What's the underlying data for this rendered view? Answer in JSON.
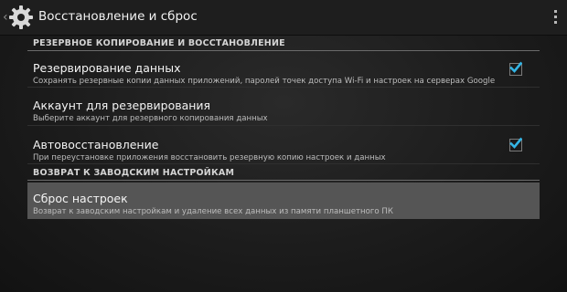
{
  "action_bar": {
    "title": "Восстановление и сброс",
    "up_icon": "chevron-left-icon",
    "app_icon": "gear-icon",
    "menu_icon": "overflow-menu-icon"
  },
  "sections": [
    {
      "header": "РЕЗЕРВНОЕ КОПИРОВАНИЕ И ВОССТАНОВЛЕНИЕ",
      "items": [
        {
          "title": "Резервирование данных",
          "summary": "Сохранять резервные копии данных приложений, паролей точек доступа Wi-Fi и настроек на серверах Google",
          "checked": true
        },
        {
          "title": "Аккаунт для резервирования",
          "summary": "Выберите аккаунт для резервного копирования данных"
        },
        {
          "title": "Автовосстановление",
          "summary": "При переустановке приложения восстановить резервную копию настроек и данных",
          "checked": true
        }
      ]
    },
    {
      "header": "ВОЗВРАТ К ЗАВОДСКИМ НАСТРОЙКАМ",
      "items": [
        {
          "title": "Сброс настроек",
          "summary": "Возврат к заводским настройкам и удаление всех данных из памяти планшетного ПК",
          "highlighted": true
        }
      ]
    }
  ],
  "colors": {
    "checkmark": "#33b5e5",
    "highlight": "#555555"
  }
}
